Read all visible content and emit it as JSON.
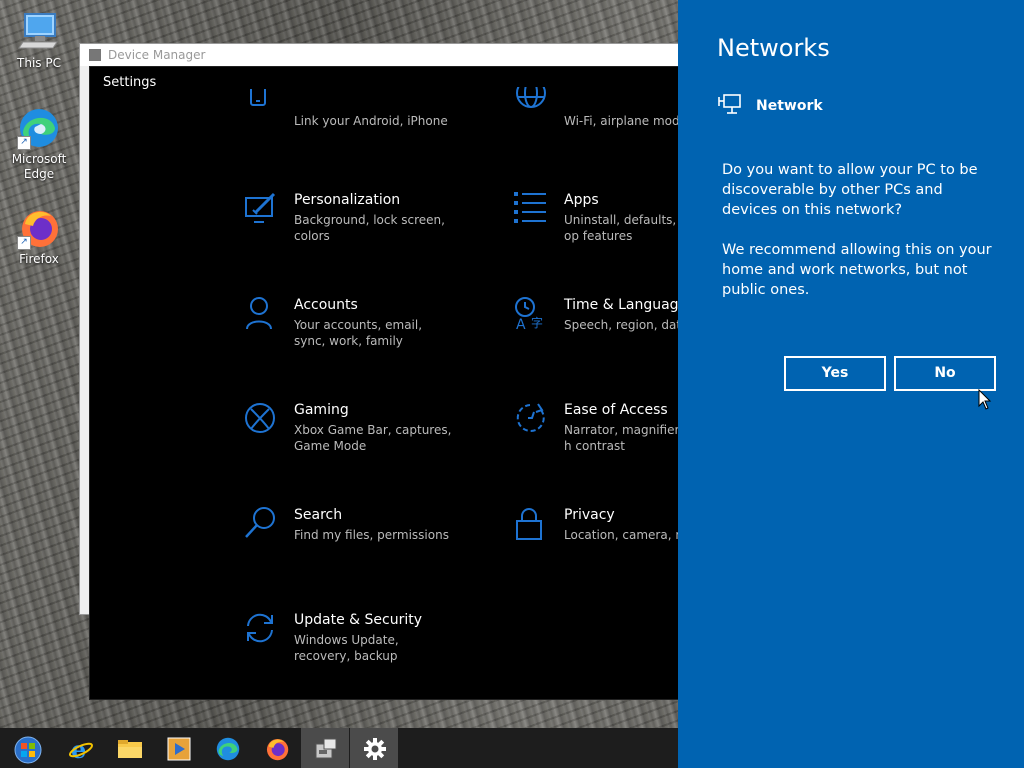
{
  "desktop": {
    "icons": [
      {
        "label": "This PC"
      },
      {
        "label": "Microsoft Edge"
      },
      {
        "label": "Firefox"
      }
    ]
  },
  "device_manager": {
    "title": "Device Manager"
  },
  "settings": {
    "title": "Settings",
    "tiles": [
      {
        "name": "",
        "desc": "Link your Android, iPhone",
        "icon": "phone-icon"
      },
      {
        "name": "",
        "desc": "Wi-Fi, airplane mode,",
        "icon": "globe-icon"
      },
      {
        "name": "Personalization",
        "desc": "Background, lock screen, colors",
        "icon": "personalization-icon"
      },
      {
        "name": "Apps",
        "desc": "Uninstall, defaults, op features",
        "icon": "apps-list-icon"
      },
      {
        "name": "Accounts",
        "desc": "Your accounts, email, sync, work, family",
        "icon": "person-icon"
      },
      {
        "name": "Time & Language",
        "desc": "Speech, region, date",
        "icon": "time-language-icon"
      },
      {
        "name": "Gaming",
        "desc": "Xbox Game Bar, captures, Game Mode",
        "icon": "xbox-icon"
      },
      {
        "name": "Ease of Access",
        "desc": "Narrator, magnifier, h contrast",
        "icon": "ease-of-access-icon"
      },
      {
        "name": "Search",
        "desc": "Find my files, permissions",
        "icon": "search-icon"
      },
      {
        "name": "Privacy",
        "desc": "Location, camera, mic",
        "icon": "lock-icon"
      },
      {
        "name": "Update & Security",
        "desc": "Windows Update, recovery, backup",
        "icon": "update-sync-icon"
      }
    ]
  },
  "flyout": {
    "title": "Networks",
    "network_name": "Network",
    "question": "Do you want to allow your PC to be discoverable by other PCs and devices on this network?",
    "recommendation": "We recommend allowing this on your home and work networks, but not public ones.",
    "yes_label": "Yes",
    "no_label": "No",
    "colors": {
      "background": "#0063b1",
      "accent_icon": "#1e73d2"
    }
  },
  "taskbar": {
    "items": [
      "start-orb-icon",
      "internet-explorer-icon",
      "file-explorer-icon",
      "media-player-icon",
      "edge-icon",
      "firefox-icon",
      "device-manager-icon",
      "settings-gear-icon"
    ]
  }
}
